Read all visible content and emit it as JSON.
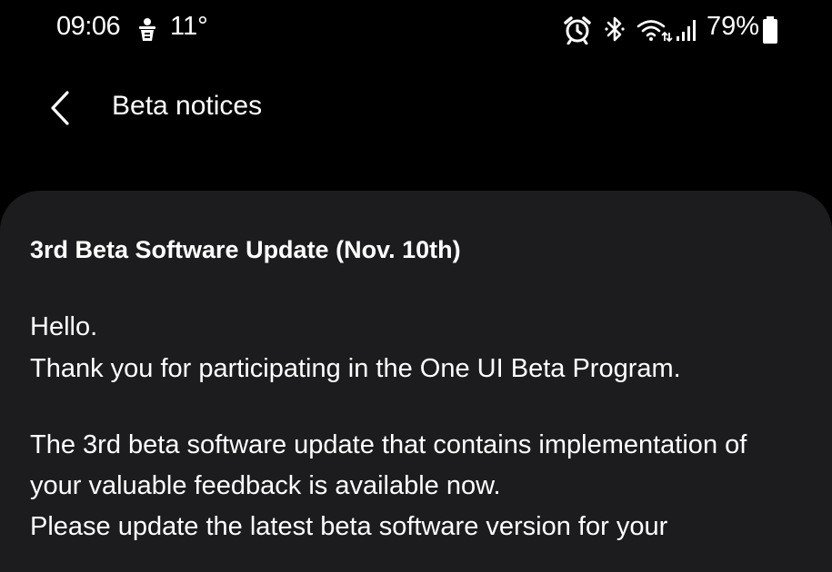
{
  "status_bar": {
    "time": "09:06",
    "temperature": "11°",
    "weather_icon": "weather-icon",
    "alarm_icon": "alarm-clock-icon",
    "bluetooth_icon": "bluetooth-icon",
    "wifi_icon": "wifi-icon",
    "signal_icon": "cellular-signal-icon",
    "battery_percent": "79%",
    "battery_level": 0.79
  },
  "header": {
    "back_icon": "chevron-left-icon",
    "title": "Beta notices"
  },
  "notice": {
    "title": "3rd Beta Software Update (Nov. 10th)",
    "greeting": "Hello.",
    "thanks": "Thank you for participating in the One UI Beta Program.",
    "paragraph_line1": "The 3rd beta software update that contains implementation of",
    "paragraph_line2": "your valuable feedback is available now.",
    "paragraph_line3": "Please update the latest beta software version for your"
  },
  "colors": {
    "background": "#000000",
    "card": "#1c1c1e",
    "text": "#ffffff"
  }
}
